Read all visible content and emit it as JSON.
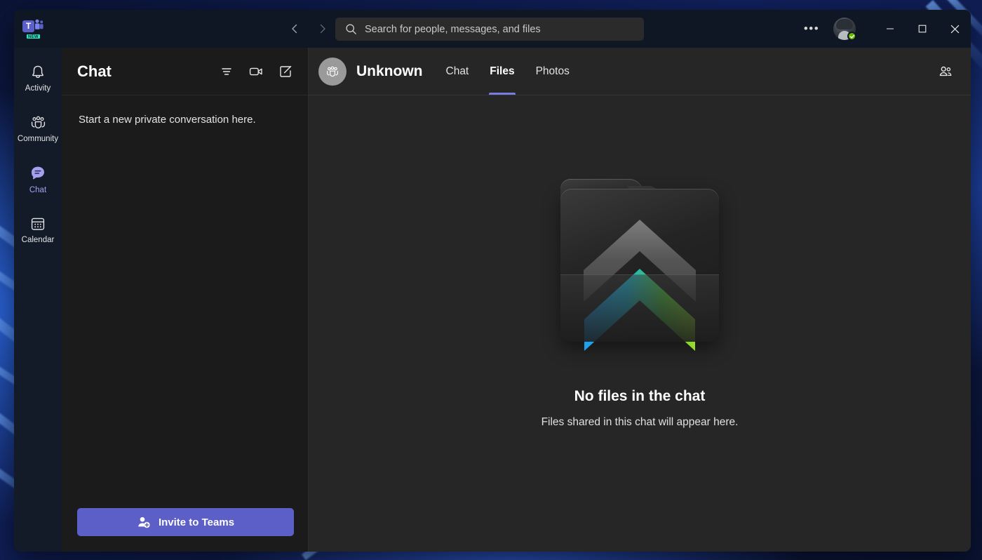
{
  "titlebar": {
    "logo_name": "teams-logo",
    "logo_letter": "T",
    "new_badge": "NEW",
    "back_label": "‹",
    "forward_label": "›",
    "more_label": "•••",
    "minimize_label": "—",
    "maximize_label": "□",
    "close_label": "✕",
    "presence": "available"
  },
  "search": {
    "placeholder": "Search for people, messages, and files",
    "value": ""
  },
  "rail": {
    "items": [
      {
        "label": "Activity",
        "icon": "bell-icon",
        "active": false
      },
      {
        "label": "Community",
        "icon": "people-community-icon",
        "active": false
      },
      {
        "label": "Chat",
        "icon": "chat-bubble-icon",
        "active": true
      },
      {
        "label": "Calendar",
        "icon": "calendar-icon",
        "active": false
      }
    ]
  },
  "chat_panel": {
    "title": "Chat",
    "icons": [
      {
        "name": "filter-icon"
      },
      {
        "name": "video-call-icon"
      },
      {
        "name": "compose-icon"
      }
    ],
    "empty_text": "Start a new private conversation here.",
    "invite_button": "Invite to Teams"
  },
  "conversation": {
    "avatar_icon": "group-avatar-icon",
    "title": "Unknown",
    "tabs": [
      {
        "label": "Chat",
        "active": false
      },
      {
        "label": "Files",
        "active": true
      },
      {
        "label": "Photos",
        "active": false
      }
    ],
    "roster_icon": "people-roster-icon"
  },
  "empty_state": {
    "illustration": "folder-files-icon",
    "title": "No files in the chat",
    "subtitle": "Files shared in this chat will appear here."
  },
  "colors": {
    "accent": "#5b5fc7",
    "tab_underline": "#7b7ae0",
    "rail_active": "#a6a0f0",
    "presence_green": "#6bb700",
    "badge_teal": "#2ee6c5"
  }
}
